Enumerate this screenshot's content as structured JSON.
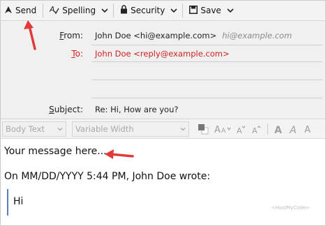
{
  "toolbar": {
    "send_label": "Send",
    "spelling_label": "Spelling",
    "security_label": "Security",
    "save_label": "Save"
  },
  "header": {
    "from_label_key": "F",
    "from_label_rest": "rom:",
    "from_value": "John Doe <hi@example.com>",
    "from_alt": "hi@example.com",
    "to_label_key": "T",
    "to_label_rest": "o:",
    "to_value": "John Doe <reply@example.com>",
    "subject_label_key": "S",
    "subject_label_rest": "ubject:",
    "subject_value": "Re: Hi, How are you?"
  },
  "format_bar": {
    "paragraph_style": "Body Text",
    "font_name": "Variable Width"
  },
  "body": {
    "message": "Your message here...",
    "attribution": "On MM/DD/YYYY 5:44 PM, John Doe wrote:",
    "quoted_text": "Hi",
    "watermark": "<HostMyCode>"
  },
  "colors": {
    "annotation_arrow": "#e03a3a",
    "recipient_text": "#d02020",
    "quote_bar": "#5a7fc0"
  }
}
